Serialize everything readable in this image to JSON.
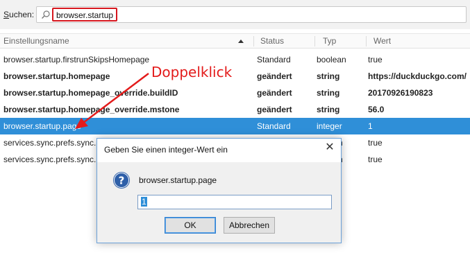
{
  "search": {
    "label_accel": "S",
    "label_rest": "uchen:",
    "value": "browser.startup"
  },
  "columns": {
    "name": "Einstellungsname",
    "status": "Status",
    "type": "Typ",
    "value": "Wert"
  },
  "rows": [
    {
      "name": "browser.startup.firstrunSkipsHomepage",
      "status": "Standard",
      "type": "boolean",
      "value": "true",
      "bold": false,
      "selected": false
    },
    {
      "name": "browser.startup.homepage",
      "status": "geändert",
      "type": "string",
      "value": "https://duckduckgo.com/",
      "bold": true,
      "selected": false
    },
    {
      "name": "browser.startup.homepage_override.buildID",
      "status": "geändert",
      "type": "string",
      "value": "20170926190823",
      "bold": true,
      "selected": false
    },
    {
      "name": "browser.startup.homepage_override.mstone",
      "status": "geändert",
      "type": "string",
      "value": "56.0",
      "bold": true,
      "selected": false
    },
    {
      "name": "browser.startup.page",
      "status": "Standard",
      "type": "integer",
      "value": "1",
      "bold": false,
      "selected": true
    },
    {
      "name": "services.sync.prefs.sync.br",
      "status": "",
      "type": "n",
      "value": "true",
      "bold": false,
      "selected": false
    },
    {
      "name": "services.sync.prefs.sync.br",
      "status": "",
      "type": "n",
      "value": "true",
      "bold": false,
      "selected": false
    }
  ],
  "annotation": {
    "text": "Doppelklick",
    "color": "#e31b1b"
  },
  "dialog": {
    "title": "Geben Sie einen integer-Wert ein",
    "prompt": "browser.startup.page",
    "input_value": "1",
    "ok_label": "OK",
    "cancel_label": "Abbrechen",
    "icon": "question-icon"
  },
  "colors": {
    "selection": "#2f8fd8",
    "highlight_border": "#d6161d"
  }
}
